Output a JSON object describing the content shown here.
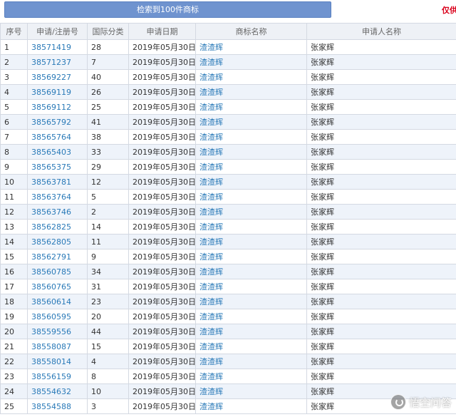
{
  "header": {
    "result_button": "检索到100件商标",
    "notice": "仅供"
  },
  "table": {
    "columns": [
      "序号",
      "申请/注册号",
      "国际分类",
      "申请日期",
      "商标名称",
      "申请人名称"
    ],
    "rows": [
      [
        "1",
        "38571419",
        "28",
        "2019年05月30日",
        "渣渣辉",
        "张家辉"
      ],
      [
        "2",
        "38571237",
        "7",
        "2019年05月30日",
        "渣渣辉",
        "张家辉"
      ],
      [
        "3",
        "38569227",
        "40",
        "2019年05月30日",
        "渣渣辉",
        "张家辉"
      ],
      [
        "4",
        "38569119",
        "26",
        "2019年05月30日",
        "渣渣辉",
        "张家辉"
      ],
      [
        "5",
        "38569112",
        "25",
        "2019年05月30日",
        "渣渣辉",
        "张家辉"
      ],
      [
        "6",
        "38565792",
        "41",
        "2019年05月30日",
        "渣渣辉",
        "张家辉"
      ],
      [
        "7",
        "38565764",
        "38",
        "2019年05月30日",
        "渣渣辉",
        "张家辉"
      ],
      [
        "8",
        "38565403",
        "33",
        "2019年05月30日",
        "渣渣辉",
        "张家辉"
      ],
      [
        "9",
        "38565375",
        "29",
        "2019年05月30日",
        "渣渣辉",
        "张家辉"
      ],
      [
        "10",
        "38563781",
        "12",
        "2019年05月30日",
        "渣渣辉",
        "张家辉"
      ],
      [
        "11",
        "38563764",
        "5",
        "2019年05月30日",
        "渣渣辉",
        "张家辉"
      ],
      [
        "12",
        "38563746",
        "2",
        "2019年05月30日",
        "渣渣辉",
        "张家辉"
      ],
      [
        "13",
        "38562825",
        "14",
        "2019年05月30日",
        "渣渣辉",
        "张家辉"
      ],
      [
        "14",
        "38562805",
        "11",
        "2019年05月30日",
        "渣渣辉",
        "张家辉"
      ],
      [
        "15",
        "38562791",
        "9",
        "2019年05月30日",
        "渣渣辉",
        "张家辉"
      ],
      [
        "16",
        "38560785",
        "34",
        "2019年05月30日",
        "渣渣辉",
        "张家辉"
      ],
      [
        "17",
        "38560765",
        "31",
        "2019年05月30日",
        "渣渣辉",
        "张家辉"
      ],
      [
        "18",
        "38560614",
        "23",
        "2019年05月30日",
        "渣渣辉",
        "张家辉"
      ],
      [
        "19",
        "38560595",
        "20",
        "2019年05月30日",
        "渣渣辉",
        "张家辉"
      ],
      [
        "20",
        "38559556",
        "44",
        "2019年05月30日",
        "渣渣辉",
        "张家辉"
      ],
      [
        "21",
        "38558087",
        "15",
        "2019年05月30日",
        "渣渣辉",
        "张家辉"
      ],
      [
        "22",
        "38558014",
        "4",
        "2019年05月30日",
        "渣渣辉",
        "张家辉"
      ],
      [
        "23",
        "38556159",
        "8",
        "2019年05月30日",
        "渣渣辉",
        "张家辉"
      ],
      [
        "24",
        "38554632",
        "10",
        "2019年05月30日",
        "渣渣辉",
        "张家辉"
      ],
      [
        "25",
        "38554588",
        "3",
        "2019年05月30日",
        "渣渣辉",
        "张家辉"
      ]
    ]
  },
  "watermark": {
    "text": "悟空问答",
    "icon": "wukong-logo-icon"
  },
  "colors": {
    "button": "#6f93cf",
    "link": "#2a7ab8",
    "notice": "#d9001b",
    "header_bg": "#eef1f6",
    "stripe": "#eef3fa",
    "border": "#d4d9e2"
  }
}
